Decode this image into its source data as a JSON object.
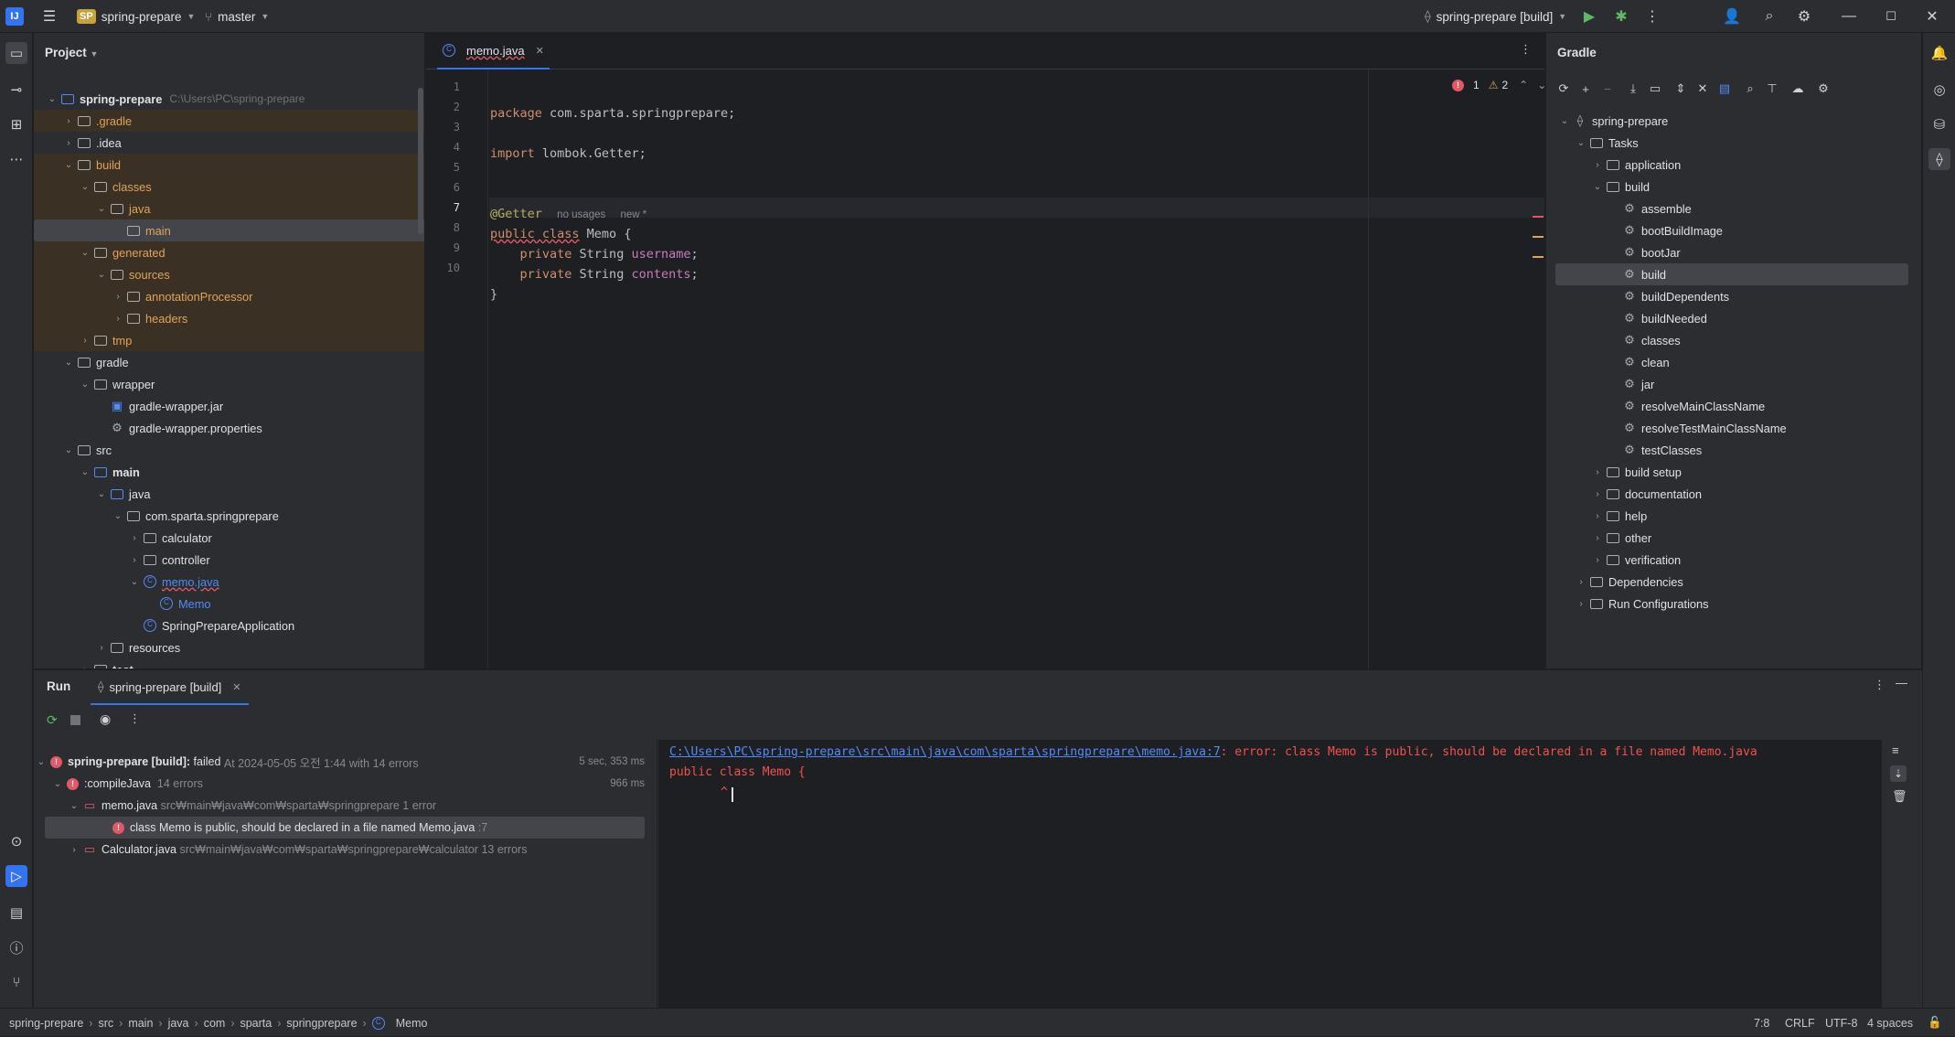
{
  "titlebar": {
    "project_badge": "SP",
    "project_name": "spring-prepare",
    "branch": "master",
    "run_config": "spring-prepare [build]"
  },
  "project_panel": {
    "title": "Project",
    "root_name": "spring-prepare",
    "root_path": "C:\\Users\\PC\\spring-prepare",
    "items": [
      {
        "label": ".gradle"
      },
      {
        "label": ".idea"
      },
      {
        "label": "build"
      },
      {
        "label": "classes"
      },
      {
        "label": "java"
      },
      {
        "label": "main"
      },
      {
        "label": "generated"
      },
      {
        "label": "sources"
      },
      {
        "label": "annotationProcessor"
      },
      {
        "label": "headers"
      },
      {
        "label": "tmp"
      },
      {
        "label": "gradle"
      },
      {
        "label": "wrapper"
      },
      {
        "label": "gradle-wrapper.jar"
      },
      {
        "label": "gradle-wrapper.properties"
      },
      {
        "label": "src"
      },
      {
        "label": "main"
      },
      {
        "label": "java"
      },
      {
        "label": "com.sparta.springprepare"
      },
      {
        "label": "calculator"
      },
      {
        "label": "controller"
      },
      {
        "label": "memo.java"
      },
      {
        "label": "Memo"
      },
      {
        "label": "SpringPrepareApplication"
      },
      {
        "label": "resources"
      },
      {
        "label": "test"
      }
    ]
  },
  "editor": {
    "tab_label": "memo.java",
    "error_count": "1",
    "warning_count": "2",
    "line_numbers": [
      "1",
      "2",
      "3",
      "4",
      "5",
      "6",
      "7",
      "8",
      "9",
      "10"
    ],
    "line1_kw": "package",
    "line1_rest": " com.sparta.springprepare;",
    "line3_kw": "import",
    "line3_rest": " lombok.Getter;",
    "line6_ann": "@Getter",
    "line6_hint1": "no usages",
    "line6_hint2": "new *",
    "line7_kw": "public class",
    "line7_rest": " Memo {",
    "line8_kw": "private",
    "line8_type": " String ",
    "line8_field": "username",
    "line9_kw": "private",
    "line9_type": " String ",
    "line9_field": "contents",
    "semicolon": ";",
    "line10": "}"
  },
  "gradle_panel": {
    "title": "Gradle",
    "root": "spring-prepare",
    "tasks_label": "Tasks",
    "groups_top": [
      "application",
      "build"
    ],
    "build_tasks": [
      "assemble",
      "bootBuildImage",
      "bootJar",
      "build",
      "buildDependents",
      "buildNeeded",
      "classes",
      "clean",
      "jar",
      "resolveMainClassName",
      "resolveTestMainClassName",
      "testClasses"
    ],
    "groups_bottom": [
      "build setup",
      "documentation",
      "help",
      "other",
      "verification"
    ],
    "dependencies": "Dependencies",
    "run_configurations": "Run Configurations"
  },
  "run_panel": {
    "title": "Run",
    "tab_label": "spring-prepare [build]",
    "tree": {
      "root_label": "spring-prepare [build]:",
      "root_status": "failed",
      "root_detail": "At 2024-05-05 오전 1:44 with 14 errors",
      "root_time": "5 sec, 353 ms",
      "compile_label": ":compileJava",
      "compile_detail": "14 errors",
      "compile_time": "966 ms",
      "memo_label": "memo.java",
      "memo_path": "src₩main₩java₩com₩sparta₩springprepare",
      "memo_count": "1 error",
      "error_msg": "class Memo is public, should be declared in a file named Memo.java",
      "error_line": ":7",
      "calc_label": "Calculator.java",
      "calc_path": "src₩main₩java₩com₩sparta₩springprepare₩calculator",
      "calc_count": "13 errors"
    },
    "console": {
      "link": "C:\\Users\\PC\\spring-prepare\\src\\main\\java\\com\\sparta\\springprepare\\memo.java:7",
      "message": ": error: class Memo is public, should be declared in a file named Memo.java",
      "line2": "public class Memo {",
      "line3": "^"
    }
  },
  "status_bar": {
    "breadcrumbs": [
      "spring-prepare",
      "src",
      "main",
      "java",
      "com",
      "sparta",
      "springprepare",
      "Memo"
    ],
    "position": "7:8",
    "line_sep": "CRLF",
    "encoding": "UTF-8",
    "indent": "4 spaces"
  },
  "colors": {
    "accent": "#3574f0",
    "error": "#e55765",
    "warning": "#e0a35b",
    "excluded_bg": "#3b3024"
  }
}
